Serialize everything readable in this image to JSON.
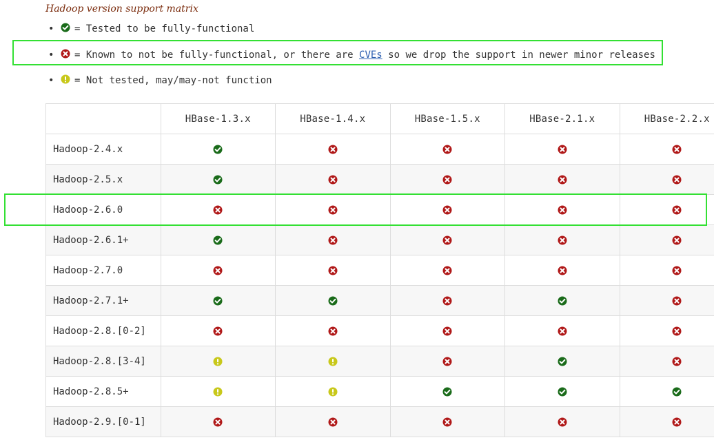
{
  "caption": "Hadoop version support matrix",
  "legend": [
    {
      "icon": "check-icon",
      "text": "= Tested to be fully-functional"
    },
    {
      "icon": "cross-icon",
      "text_before": "= Known to not be fully-functional, or there are ",
      "link": "CVEs",
      "text_after": " so we drop the support in newer minor releases"
    },
    {
      "icon": "warning-icon",
      "text": "= Not tested, may/may-not function"
    }
  ],
  "colors": {
    "check": "#1a6b1a",
    "cross": "#b01818",
    "warning": "#c8c81a",
    "highlight": "#33e033",
    "caption": "#7a2b0c",
    "link": "#2a5db0"
  },
  "table": {
    "headers": [
      "",
      "HBase-1.3.x",
      "HBase-1.4.x",
      "HBase-1.5.x",
      "HBase-2.1.x",
      "HBase-2.2.x"
    ],
    "rows": [
      {
        "label": "Hadoop-2.4.x",
        "status": [
          "yes",
          "no",
          "no",
          "no",
          "no"
        ]
      },
      {
        "label": "Hadoop-2.5.x",
        "status": [
          "yes",
          "no",
          "no",
          "no",
          "no"
        ]
      },
      {
        "label": "Hadoop-2.6.0",
        "status": [
          "no",
          "no",
          "no",
          "no",
          "no"
        ]
      },
      {
        "label": "Hadoop-2.6.1+",
        "status": [
          "yes",
          "no",
          "no",
          "no",
          "no"
        ]
      },
      {
        "label": "Hadoop-2.7.0",
        "status": [
          "no",
          "no",
          "no",
          "no",
          "no"
        ]
      },
      {
        "label": "Hadoop-2.7.1+",
        "status": [
          "yes",
          "yes",
          "no",
          "yes",
          "no"
        ]
      },
      {
        "label": "Hadoop-2.8.[0-2]",
        "status": [
          "no",
          "no",
          "no",
          "no",
          "no"
        ]
      },
      {
        "label": "Hadoop-2.8.[3-4]",
        "status": [
          "untested",
          "untested",
          "no",
          "yes",
          "no"
        ]
      },
      {
        "label": "Hadoop-2.8.5+",
        "status": [
          "untested",
          "untested",
          "yes",
          "yes",
          "yes"
        ]
      },
      {
        "label": "Hadoop-2.9.[0-1]",
        "status": [
          "no",
          "no",
          "no",
          "no",
          "no"
        ]
      }
    ]
  }
}
